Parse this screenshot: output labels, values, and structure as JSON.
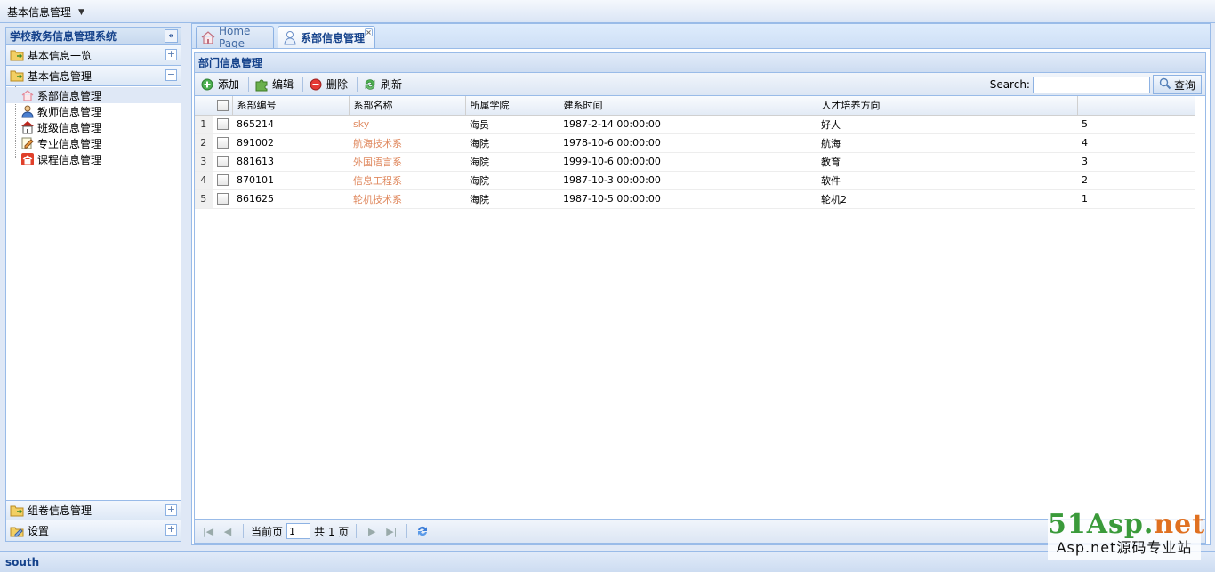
{
  "topbar": {
    "menu_label": "基本信息管理"
  },
  "west": {
    "title": "学校教务信息管理系统",
    "sections": [
      {
        "label": "基本信息一览",
        "toggle": "+"
      },
      {
        "label": "基本信息管理",
        "toggle": "−"
      }
    ],
    "tree_items": [
      {
        "label": "系部信息管理",
        "icon": "home-outline-icon"
      },
      {
        "label": "教师信息管理",
        "icon": "user-icon"
      },
      {
        "label": "班级信息管理",
        "icon": "building-icon"
      },
      {
        "label": "专业信息管理",
        "icon": "document-edit-icon"
      },
      {
        "label": "课程信息管理",
        "icon": "home-red-icon"
      }
    ],
    "bottom_sections": [
      {
        "label": "组卷信息管理",
        "toggle": "+"
      },
      {
        "label": "设置",
        "toggle": "+"
      }
    ]
  },
  "tabs": [
    {
      "label": "Home Page",
      "icon": "home-icon"
    },
    {
      "label": "系部信息管理",
      "icon": "user-icon"
    }
  ],
  "grid": {
    "title": "部门信息管理",
    "toolbar": {
      "add": "添加",
      "edit": "编辑",
      "delete": "删除",
      "refresh": "刷新"
    },
    "search": {
      "label": "Search:",
      "value": "",
      "button": "查询"
    },
    "columns": [
      "系部编号",
      "系部名称",
      "所属学院",
      "建系时间",
      "人才培养方向",
      ""
    ],
    "rows": [
      {
        "num": "1",
        "id": "865214",
        "name": "sky",
        "college": "海员",
        "date": "1987-2-14 00:00:00",
        "direction": "好人",
        "order": "5"
      },
      {
        "num": "2",
        "id": "891002",
        "name": "航海技术系",
        "college": "海院",
        "date": "1978-10-6 00:00:00",
        "direction": "航海",
        "order": "4"
      },
      {
        "num": "3",
        "id": "881613",
        "name": "外国语言系",
        "college": "海院",
        "date": "1999-10-6 00:00:00",
        "direction": "教育",
        "order": "3"
      },
      {
        "num": "4",
        "id": "870101",
        "name": "信息工程系",
        "college": "海院",
        "date": "1987-10-3 00:00:00",
        "direction": "软件",
        "order": "2"
      },
      {
        "num": "5",
        "id": "861625",
        "name": "轮机技术系",
        "college": "海院",
        "date": "1987-10-5 00:00:00",
        "direction": "轮机2",
        "order": "1"
      }
    ]
  },
  "pager": {
    "current_label": "当前页",
    "current_value": "1",
    "total_label": "共 1 页"
  },
  "south": {
    "label": "south"
  },
  "watermark": {
    "line1a": "51Asp.",
    "line1b": "net",
    "line2": "Asp.net源码专业站"
  },
  "colors": {
    "accent": "#15428b",
    "border": "#99bbe8",
    "link": "#e08a60"
  }
}
